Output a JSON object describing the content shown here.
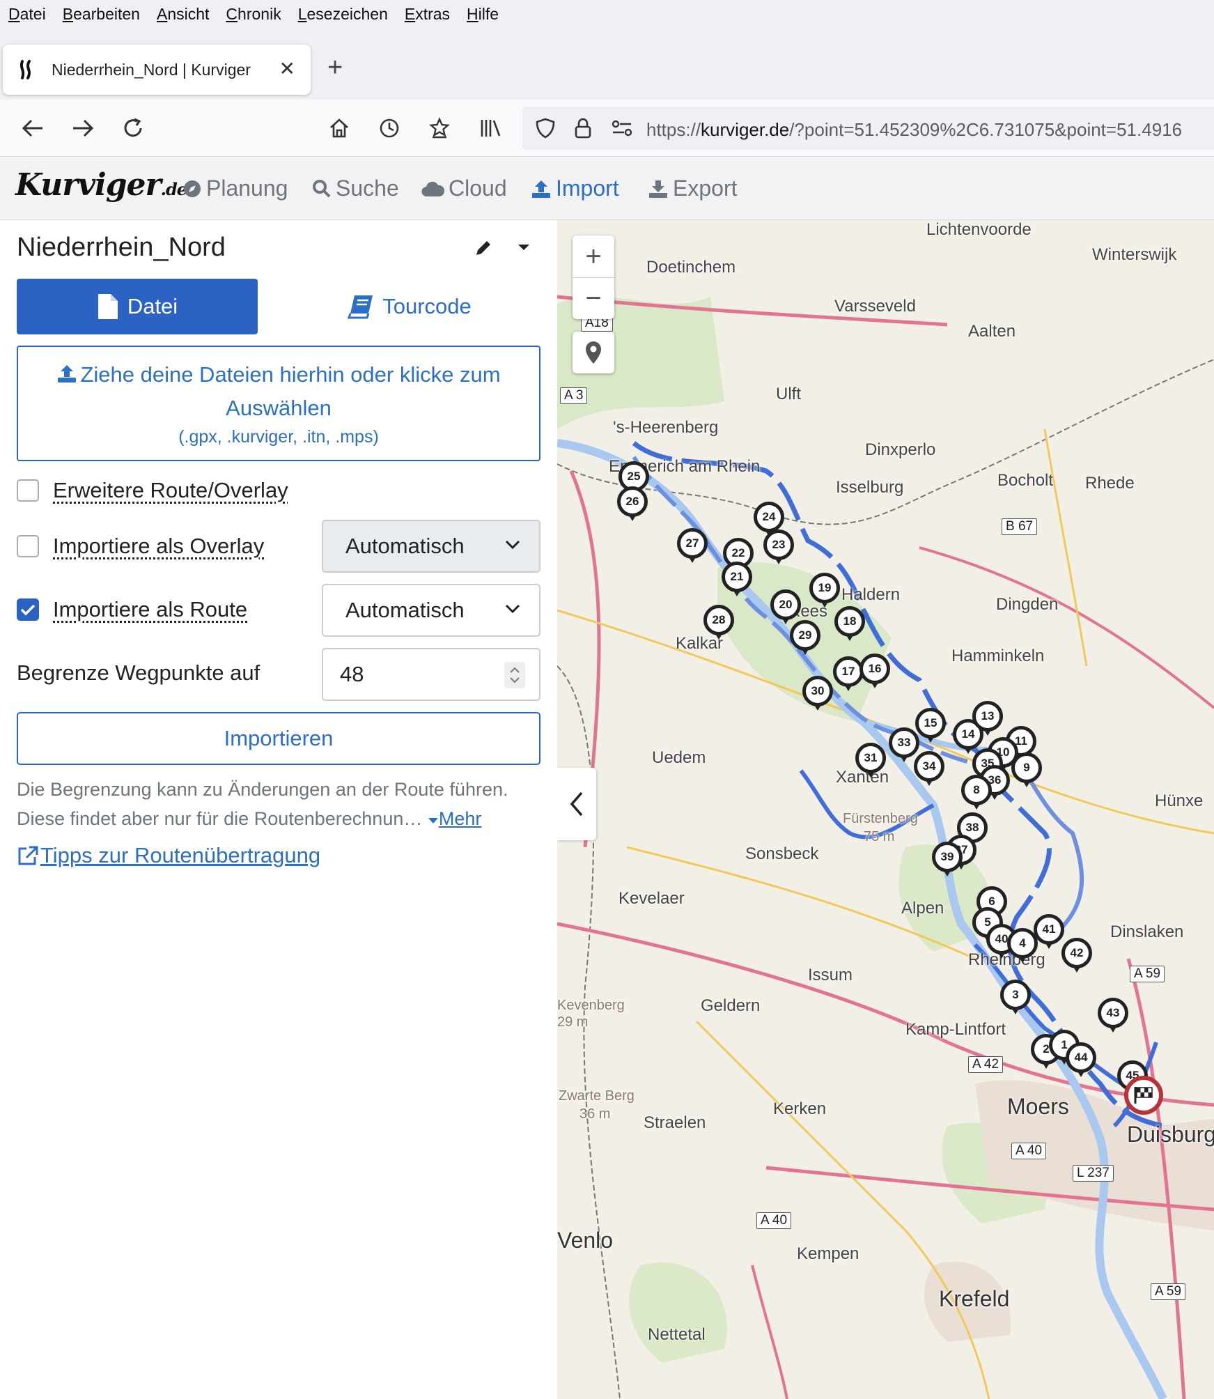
{
  "menubar": {
    "items": [
      {
        "first": "D",
        "rest": "atei"
      },
      {
        "first": "B",
        "rest": "earbeiten"
      },
      {
        "first": "A",
        "rest": "nsicht"
      },
      {
        "first": "C",
        "rest": "hronik"
      },
      {
        "first": "L",
        "rest": "esezeichen"
      },
      {
        "first": "E",
        "rest": "xtras"
      },
      {
        "first": "H",
        "rest": "ilfe"
      }
    ]
  },
  "tab": {
    "title": "Niederrhein_Nord | Kurviger",
    "close": "✕",
    "new": "+"
  },
  "url": {
    "scheme": "https://",
    "host": "kurviger.de",
    "rest": "/?point=51.452309%2C6.731075&point=51.4916"
  },
  "app": {
    "brand": "Kurviger",
    "brand_suffix": ".de",
    "nav": {
      "planung": "Planung",
      "suche": "Suche",
      "cloud": "Cloud",
      "import": "Import",
      "export": "Export"
    }
  },
  "sidebar": {
    "route_name": "Niederrhein_Nord",
    "tab_datei": "Datei",
    "tab_tourcode": "Tourcode",
    "dropzone_main": "Ziehe deine Dateien hierhin oder klicke zum Auswählen",
    "dropzone_sub": "(.gpx, .kurviger, .itn, .mps)",
    "opt_extend": "Erweitere Route/Overlay",
    "opt_overlay": "Importiere als Overlay",
    "opt_overlay_select": "Automatisch",
    "opt_route": "Importiere als Route",
    "opt_route_select": "Automatisch",
    "opt_route_checked": true,
    "limit_label": "Begrenze Wegpunkte auf",
    "limit_value": "48",
    "import_button": "Importieren",
    "hint": "Die Begrenzung kann zu Änderungen an der Route führen. Diese findet aber nur für die Routenberechnun…",
    "hint_more": "Mehr",
    "tips": "Tipps zur Routenübertragung"
  },
  "map": {
    "places": [
      "Lichtenvoorde",
      "Winterswijk",
      "Doetinchem",
      "Varsseveld",
      "Aalten",
      "Ulft",
      "'s-Heerenberg",
      "Dinxperlo",
      "Emmerich am Rhein",
      "Isselburg",
      "Bocholt",
      "Rhede",
      "Haldern",
      "Dingden",
      "Rees",
      "Kalkar",
      "Hamminkeln",
      "Uedem",
      "Xanten",
      "Hünxe",
      "Fürstenberg",
      "75 m",
      "Sonsbeck",
      "Kevelaer",
      "Alpen",
      "Dinslaken",
      "Issum",
      "Rheinberg",
      "Geldern",
      "Kamp-Lintfort",
      "Moers",
      "Duisburg",
      "Kerken",
      "Straelen",
      "Zwarte Berg",
      "36 m",
      "Kempen",
      "Krefeld",
      "Nettetal",
      "Venlo",
      "Kevenberg",
      "29 m"
    ],
    "roads": [
      "A18",
      "A 3",
      "B 67",
      "A 59",
      "A 42",
      "A 40",
      "L 237",
      "A 40",
      "A 59"
    ],
    "zoom_in": "+",
    "zoom_out": "−",
    "waypoints": [
      "25",
      "26",
      "27",
      "24",
      "23",
      "22",
      "21",
      "28",
      "20",
      "29",
      "19",
      "18",
      "17",
      "16",
      "30",
      "31",
      "33",
      "15",
      "34",
      "14",
      "13",
      "11",
      "10",
      "35",
      "36",
      "9",
      "8",
      "38",
      "37",
      "39",
      "6",
      "5",
      "40",
      "4",
      "41",
      "42",
      "3",
      "43",
      "2",
      "1",
      "44",
      "45"
    ]
  }
}
